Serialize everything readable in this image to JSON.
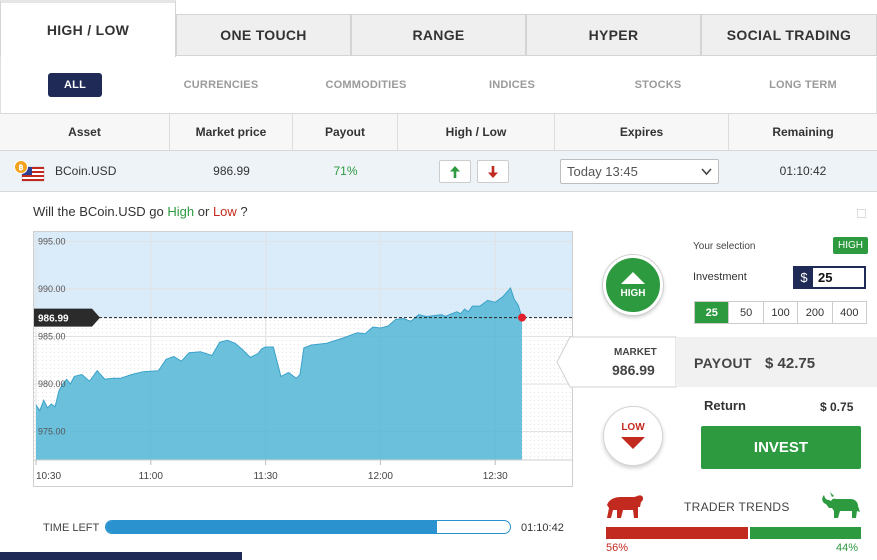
{
  "tabs": [
    "HIGH / LOW",
    "ONE TOUCH",
    "RANGE",
    "HYPER",
    "SOCIAL TRADING"
  ],
  "filters": [
    "ALL",
    "CURRENCIES",
    "COMMODITIES",
    "INDICES",
    "STOCKS",
    "LONG TERM"
  ],
  "table": {
    "headers": [
      "Asset",
      "Market price",
      "Payout",
      "High / Low",
      "Expires",
      "Remaining"
    ],
    "row": {
      "asset": "BCoin.USD",
      "market_price": "986.99",
      "payout": "71%",
      "expires": "Today 13:45",
      "remaining": "01:10:42"
    }
  },
  "question": {
    "prefix": "Will the BCoin.USD go ",
    "high": "High",
    "mid": " or ",
    "low": "Low",
    "suffix": " ?"
  },
  "chart_data": {
    "type": "area",
    "ylim": [
      972,
      996
    ],
    "y_ticks": [
      "995.00",
      "990.00",
      "985.00",
      "980.00",
      "975.00"
    ],
    "y_tick_values": [
      995,
      990,
      985,
      980,
      975
    ],
    "x_ticks": [
      "10:30",
      "11:00",
      "11:30",
      "12:00",
      "12:30"
    ],
    "x_tick_minutes": [
      0,
      30,
      60,
      90,
      120
    ],
    "xlim": [
      0,
      127
    ],
    "current_label": "986.99",
    "current_value": 986.99,
    "series": [
      {
        "x": [
          0,
          1,
          2,
          3,
          4,
          5,
          6,
          7,
          8,
          9,
          10,
          12,
          14,
          16,
          18,
          20,
          22,
          25,
          28,
          32,
          34,
          36,
          38,
          40,
          43,
          46,
          48,
          50,
          52,
          54,
          56,
          58,
          59,
          60,
          62,
          64,
          66,
          68,
          69,
          70,
          72,
          74,
          76,
          80,
          84,
          86,
          88,
          90,
          92,
          94,
          96,
          98,
          100,
          102,
          104,
          106,
          107,
          108,
          110,
          111,
          112,
          113,
          114,
          116,
          118,
          120,
          122,
          124,
          125,
          126,
          127
        ],
        "y": [
          977.8,
          977.2,
          978.3,
          977.5,
          977.9,
          977.6,
          979.3,
          980.0,
          980.5,
          980.0,
          980.8,
          981.0,
          980.3,
          981.4,
          980.5,
          980.6,
          980.6,
          981.0,
          981.3,
          981.4,
          982.6,
          982.9,
          982.4,
          983.3,
          983.4,
          983.0,
          984.4,
          984.6,
          984.3,
          983.6,
          982.8,
          983.2,
          983.7,
          983.9,
          983.9,
          980.8,
          981.2,
          980.6,
          981.0,
          983.8,
          984.1,
          984.2,
          984.3,
          984.8,
          985.4,
          985.3,
          986.0,
          985.9,
          986.1,
          986.8,
          986.9,
          986.6,
          987.3,
          987.1,
          987.2,
          987.3,
          987.1,
          987.3,
          987.6,
          987.4,
          987.9,
          987.6,
          988.2,
          988.2,
          988.8,
          988.6,
          989.2,
          990.1,
          988.9,
          988.3,
          986.99
        ]
      }
    ]
  },
  "time_left": {
    "label": "TIME LEFT",
    "value": "01:10:42",
    "progress": 0.82
  },
  "right": {
    "high_label": "HIGH",
    "low_label": "LOW",
    "your_selection_label": "Your selection",
    "selection_value": "HIGH",
    "investment_label": "Investment",
    "currency": "$",
    "investment_value": "25",
    "amounts": [
      "25",
      "50",
      "100",
      "200",
      "400"
    ],
    "selected_amount": "25",
    "market_label": "MARKET",
    "market_value": "986.99",
    "payout_label": "PAYOUT",
    "payout_value": "$ 42.75",
    "return_label": "Return",
    "return_value": "$ 0.75",
    "invest_label": "INVEST",
    "trends_label": "TRADER TRENDS",
    "bear_pct": "56%",
    "bull_pct": "44%",
    "bear_value": 56,
    "bull_value": 44
  },
  "colors": {
    "navy": "#1f2b56",
    "green": "#2d9a3f",
    "red": "#c32a1f",
    "blue": "#2a93cf",
    "area": "#5bbad8"
  }
}
